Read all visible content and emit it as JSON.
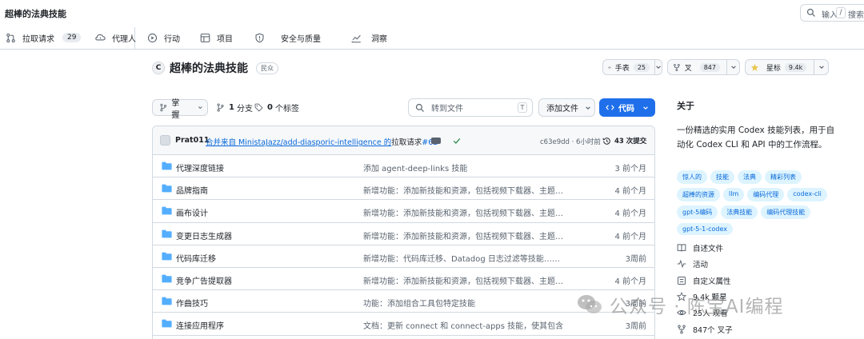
{
  "header": {
    "title": "超棒的法典技能",
    "search_label": "输入",
    "search_key": "/",
    "search_label2": "搜索"
  },
  "nav": {
    "items": [
      {
        "label": "拉取请求",
        "count": "29",
        "icon": "pull-request-icon"
      },
      {
        "label": "代理人",
        "icon": "agent-icon"
      },
      {
        "label": "行动",
        "icon": "actions-icon"
      },
      {
        "label": "项目",
        "icon": "projects-icon"
      },
      {
        "label": "安全与质量",
        "icon": "shield-icon"
      },
      {
        "label": "洞察",
        "icon": "graph-icon"
      }
    ]
  },
  "repo": {
    "avatar_letter": "C",
    "name": "超棒的法典技能",
    "visibility": "民众",
    "watch_label": "手表",
    "watch_count": "25",
    "fork_label": "叉",
    "fork_count": "847",
    "star_label": "星标",
    "star_count": "9.4k"
  },
  "toolbar": {
    "branch": "掌握",
    "branches_count": "1",
    "branches_label": "分支",
    "tags_count": "0",
    "tags_label": "个标签",
    "goto_placeholder": "转到文件",
    "goto_key": "T",
    "add_file": "添加文件",
    "code": "代码"
  },
  "commit": {
    "author": "Prat011",
    "msg_link": "合并来自 MinistaJazz/add-diasporic-intelligence 的",
    "msg_tail": "拉取请求",
    "pr_link": "#62",
    "hash_time": "c63e9dd · 6小时前",
    "history": "43 次提交"
  },
  "files": [
    {
      "name": "代理深度链接",
      "msg": "添加 agent-deep-links 技能",
      "time": "3 前个月"
    },
    {
      "name": "品牌指南",
      "msg": "新增功能：添加新技能和资源，包括视频下载器、主题……",
      "time": "4 前个月"
    },
    {
      "name": "画布设计",
      "msg": "新增功能：添加新技能和资源，包括视频下载器、主题……",
      "time": "4 前个月"
    },
    {
      "name": "变更日志生成器",
      "msg": "新增功能：添加新技能和资源，包括视频下载器、主题……",
      "time": "4 前个月"
    },
    {
      "name": "代码库迁移",
      "msg": "新增功能：代码库迁移、Datadog 日志过滤等技能……",
      "time": "3周前"
    },
    {
      "name": "竞争广告提取器",
      "msg": "新增功能：添加新技能和资源，包括视频下载器、主题……",
      "time": "4 前个月"
    },
    {
      "name": "作曲技巧",
      "msg": "功能：添加组合工具包特定技能",
      "time": "3周前"
    },
    {
      "name": "连接应用程序",
      "msg": "文档：更新 connect 和 connect-apps 技能，使其包含 Comp…",
      "time": "3周前"
    }
  ],
  "about": {
    "title": "关于",
    "description": "一份精选的实用 Codex 技能列表，用于自动化 Codex CLI 和 API 中的工作流程。",
    "topics": [
      "惊人的",
      "技能",
      "法典",
      "精彩列表",
      "超棒的资源",
      "llm",
      "编码代理",
      "codex-cli",
      "gpt-5编码",
      "法典技能",
      "编码代理技能",
      "gpt-5-1-codex"
    ],
    "stats": [
      {
        "label": "自述文件",
        "icon": "book-icon"
      },
      {
        "label": "活动",
        "icon": "pulse-icon"
      },
      {
        "label": "自定义属性",
        "icon": "properties-icon"
      },
      {
        "label": "9.4k 颗星",
        "icon": "star-icon"
      },
      {
        "label": "25人 观看",
        "icon": "eye-icon"
      },
      {
        "label": "847个 叉子",
        "icon": "fork-icon"
      }
    ]
  },
  "watermark": {
    "text": "公众号 · 陈宝AI编程"
  }
}
